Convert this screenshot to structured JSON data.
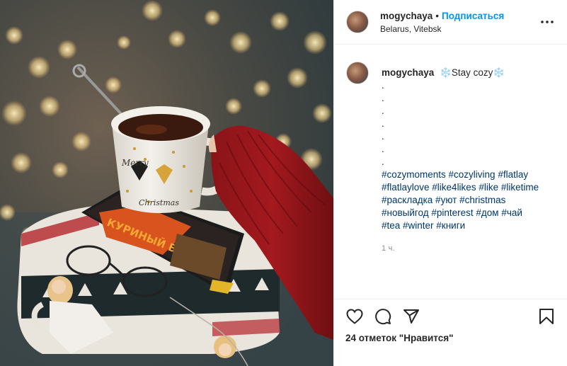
{
  "header": {
    "username": "mogychaya",
    "separator": "•",
    "follow_label": "Подписаться",
    "location": "Belarus, Vitebsk",
    "more_icon": "more-horizontal-icon"
  },
  "caption": {
    "username": "mogychaya",
    "text": "❄️Stay cozy❄️",
    "dots": [
      ".",
      ".",
      ".",
      ".",
      ".",
      ".",
      "."
    ],
    "hashtags": [
      "#cozymoments #cozyliving #flatlay",
      "#flatlaylove #like4likes #like #liketime",
      "#раскладка #уют #christmas",
      "#новыйгод #pinterest #дом #чай",
      "#tea #winter #книги"
    ],
    "time": "1 ч."
  },
  "actions": {
    "like_icon": "heart-icon",
    "comment_icon": "comment-icon",
    "share_icon": "share-icon",
    "save_icon": "bookmark-icon",
    "likes_text": "24 отметок \"Нравится\""
  },
  "photo": {
    "mug_text_1": "Merry",
    "mug_text_2": "Christmas",
    "book_text": "КУРИНЫЙ БУЛЬОН"
  }
}
